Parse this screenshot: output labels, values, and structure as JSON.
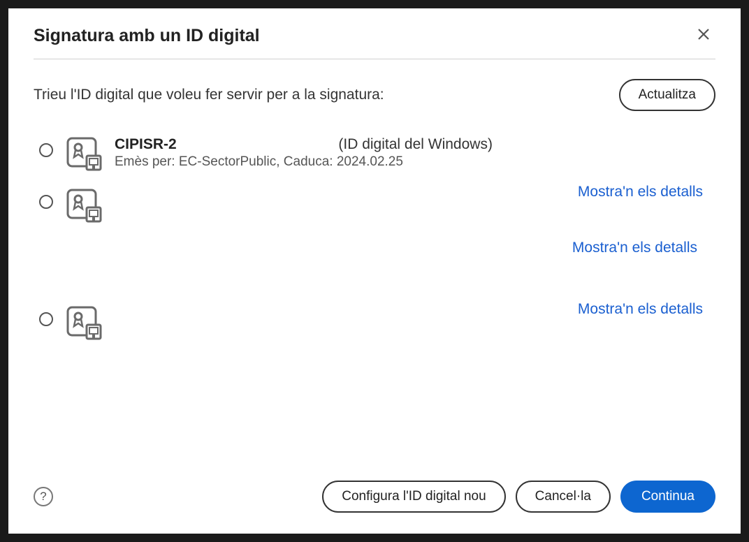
{
  "dialog": {
    "title": "Signatura amb un ID digital",
    "instruction": "Trieu l'ID digital que voleu fer servir per a la signatura:",
    "refresh_label": "Actualitza",
    "details_label": "Mostra'n els detalls",
    "configure_label": "Configura l'ID digital nou",
    "cancel_label": "Cancel·la",
    "continue_label": "Continua"
  },
  "certificates": [
    {
      "name": "CIPISR-2",
      "suffix": "(ID digital del Windows)",
      "issuer_line": "Emès per: EC-SectorPublic, Caduca: 2024.02.25"
    },
    {
      "name": "",
      "suffix": "",
      "issuer_line": ""
    },
    {
      "name": "",
      "suffix": "",
      "issuer_line": ""
    }
  ]
}
